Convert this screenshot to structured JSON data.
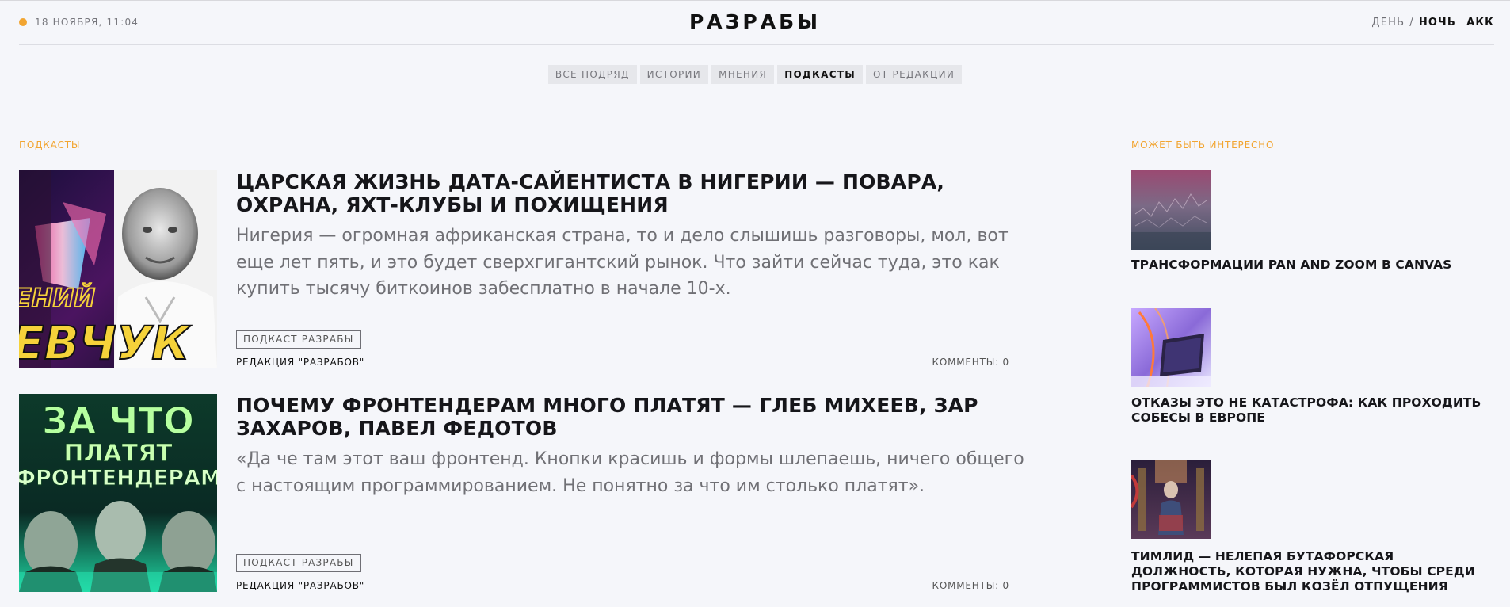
{
  "header": {
    "datetime": "18 НОЯБРЯ, 11:04",
    "logo": "РАЗРАБЫ",
    "theme_day": "ДЕНЬ",
    "theme_separator": "/",
    "theme_night": "НОЧЬ",
    "account": "АКК",
    "accent_color": "#f2a531"
  },
  "tabs": [
    {
      "label": "ВСЕ ПОДРЯД",
      "active": false
    },
    {
      "label": "ИСТОРИИ",
      "active": false
    },
    {
      "label": "МНЕНИЯ",
      "active": false
    },
    {
      "label": "ПОДКАСТЫ",
      "active": true
    },
    {
      "label": "ОТ РЕДАКЦИИ",
      "active": false
    }
  ],
  "main": {
    "section_label": "ПОДКАСТЫ",
    "articles": [
      {
        "title": "ЦАРСКАЯ ЖИЗНЬ ДАТА-САЙЕНТИСТА В НИГЕРИИ — ПОВАРА, ОХРАНА, ЯХТ-КЛУБЫ И ПОХИЩЕНИЯ",
        "excerpt": "Нигерия — огромная африканская страна, то и дело слышишь разговоры, мол, вот еще лет пять, и это будет сверхгигантский рынок. Что зайти сейчас туда, это как купить тысячу биткоинов забесплатно в начале 10-х.",
        "tag": "ПОДКАСТ РАЗРАБЫ",
        "author": "РЕДАКЦИЯ \"РАЗРАБОВ\"",
        "comments": "КОММЕНТЫ: 0",
        "thumb_text": "ЕВЧУК",
        "thumb_text_top": "ЕНИЙ"
      },
      {
        "title": "ПОЧЕМУ ФРОНТЕНДЕРАМ МНОГО ПЛАТЯТ — ГЛЕБ МИХЕЕВ, ЗАР ЗАХАРОВ, ПАВЕЛ ФЕДОТОВ",
        "excerpt": "«Да че там этот ваш фронтенд. Кнопки красишь и формы шлепаешь, ничего общего с настоящим программированием. Не понятно за что им столько платят».",
        "tag": "ПОДКАСТ РАЗРАБЫ",
        "author": "РЕДАКЦИЯ \"РАЗРАБОВ\"",
        "comments": "КОММЕНТЫ: 0",
        "thumb_line1": "ЗА ЧТО",
        "thumb_line2": "ПЛАТЯТ",
        "thumb_line3": "ФРОНТЕНДЕРАМ"
      }
    ]
  },
  "sidebar": {
    "section_label": "МОЖЕТ БЫТЬ ИНТЕРЕСНО",
    "items": [
      {
        "title": "ТРАНСФОРМАЦИИ PAN AND ZOOM В CANVAS"
      },
      {
        "title": "ОТКАЗЫ ЭТО НЕ КАТАСТРОФА: КАК ПРОХОДИТЬ СОБЕСЫ В ЕВРОПЕ"
      },
      {
        "title": "ТИМЛИД — НЕЛЕПАЯ БУТАФОРСКАЯ ДОЛЖНОСТЬ, КОТОРАЯ НУЖНА, ЧТОБЫ СРЕДИ ПРОГРАММИСТОВ БЫЛ КОЗЁЛ ОТПУЩЕНИЯ"
      }
    ]
  }
}
